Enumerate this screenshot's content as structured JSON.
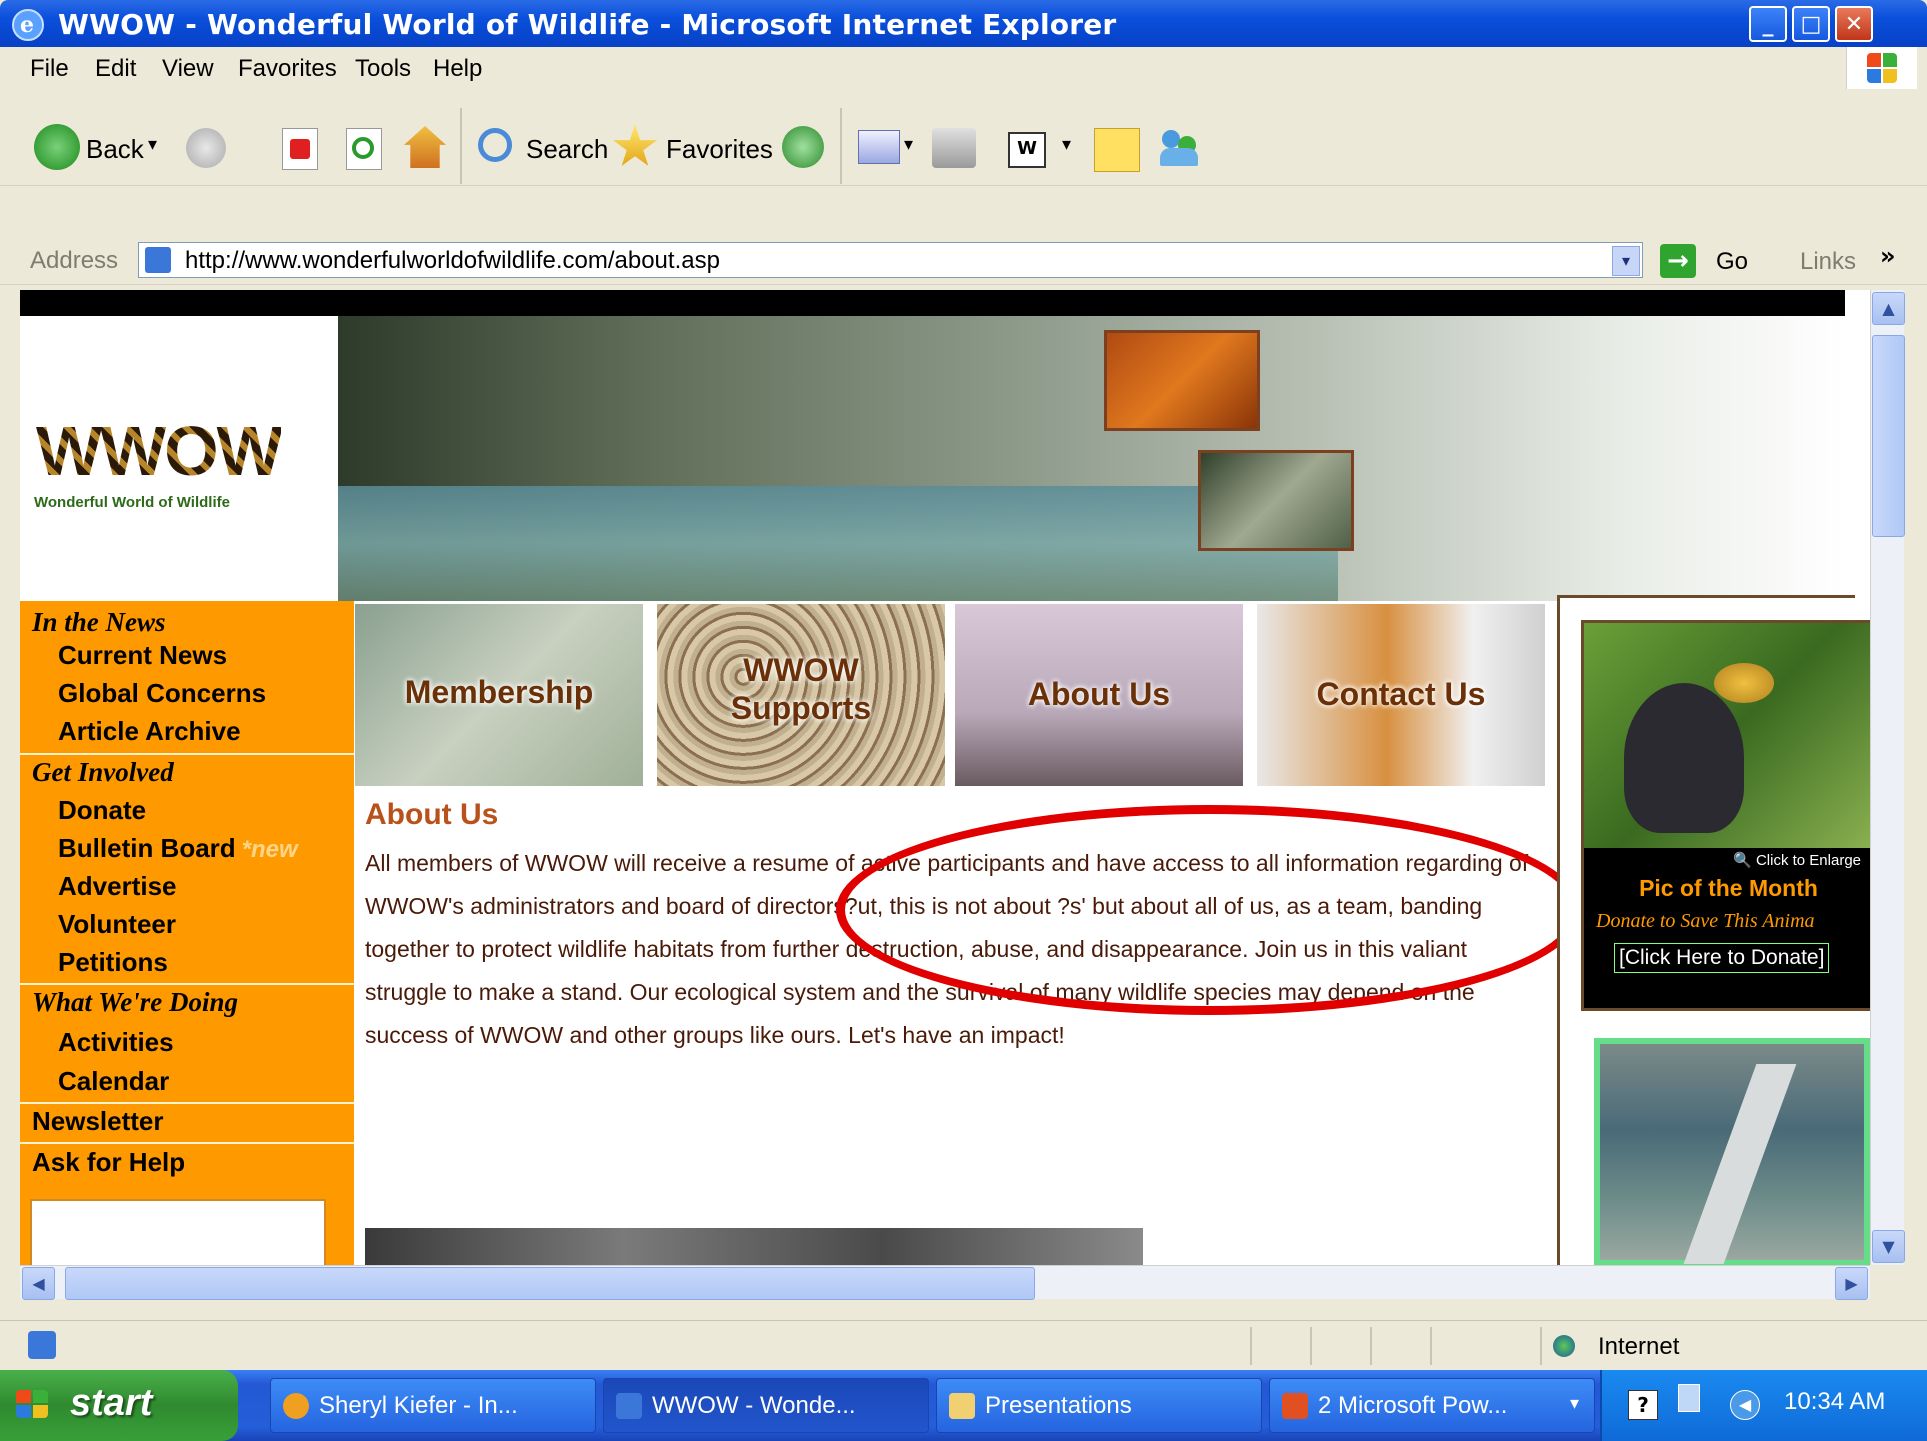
{
  "window": {
    "title": "WWOW - Wonderful World of Wildlife - Microsoft Internet Explorer",
    "min_glyph": "_",
    "max_glyph": "□",
    "close_glyph": "✕"
  },
  "menu": [
    "File",
    "Edit",
    "View",
    "Favorites",
    "Tools",
    "Help"
  ],
  "toolbar": {
    "back_label": "Back",
    "search_label": "Search",
    "favorites_label": "Favorites",
    "dropdown_glyph": "▾"
  },
  "address": {
    "label": "Address",
    "url": "http://www.wonderfulworldofwildlife.com/about.asp",
    "go_label": "Go",
    "links_label": "Links",
    "links_chevron": "»"
  },
  "site": {
    "logo_text": "WWOW",
    "logo_subtitle": "Wonderful World of Wildlife",
    "sidebar": {
      "in_the_news": "In the News",
      "current_news": "Current News",
      "global_concerns": "Global Concerns",
      "article_archive": "Article Archive",
      "get_involved": "Get Involved",
      "donate": "Donate",
      "bulletin_board": "Bulletin Board",
      "new_tag": "*new",
      "advertise": "Advertise",
      "volunteer": "Volunteer",
      "petitions": "Petitions",
      "what_were_doing": "What We're Doing",
      "activities": "Activities",
      "calendar": "Calendar",
      "newsletter": "Newsletter",
      "ask_for_help": "Ask for Help"
    },
    "tiles": {
      "membership": "Membership",
      "wwow": "WWOW",
      "supports": "Supports",
      "about_us": "About Us",
      "contact_us": "Contact Us"
    },
    "about": {
      "title": "About Us",
      "body": "All members of WWOW will receive a resume of active participants and have access to all information regarding of WWOW's administrators and board of directors?ut, this is not about ?s' but about all of us, as a team, banding together to protect wildlife habitats from further destruction, abuse, and disappearance. Join us in this valiant struggle to make a stand. Our ecological system and the survival of many wildlife species may depend on the success of WWOW and other groups like ours. Let's have an impact!"
    },
    "pic_of_month": {
      "enlarge": "🔍 Click to Enlarge",
      "title": "Pic of the Month",
      "donate_text": "Donate to Save This Anima",
      "click_donate": "[Click Here to Donate]"
    }
  },
  "scroll": {
    "up": "▲",
    "down": "▼",
    "left": "◀",
    "right": "▶"
  },
  "status": {
    "zone": "Internet"
  },
  "taskbar": {
    "start_label": "start",
    "tasks": [
      "Sheryl Kiefer - In...",
      "WWOW - Wonde...",
      "Presentations",
      "2 Microsoft Pow..."
    ],
    "dropdown_glyph": "▾",
    "help_glyph": "?",
    "tray_arrow": "◀",
    "clock": "10:34 AM"
  },
  "colors": {
    "sidebar_orange": "#ff9900",
    "about_title": "#b8521a",
    "highlight_oval": "#e00000",
    "pic_border": "#66dd88"
  }
}
